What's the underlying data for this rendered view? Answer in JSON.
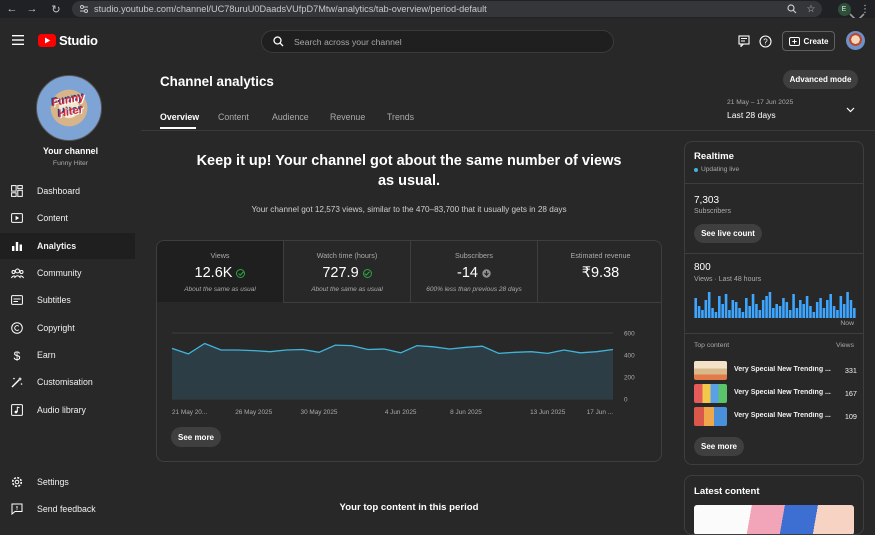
{
  "browser": {
    "url": "studio.youtube.com/channel/UC78uruU0DaadsVUfpD7Mtw/analytics/tab-overview/period-default",
    "profile_initial": "E"
  },
  "topbar": {
    "logo_text": "Studio",
    "search_placeholder": "Search across your channel",
    "create_label": "Create"
  },
  "sidebar": {
    "channel_name": "Your channel",
    "channel_handle": "Funny Hiter",
    "items": [
      {
        "label": "Dashboard",
        "icon": "dashboard-icon"
      },
      {
        "label": "Content",
        "icon": "content-icon"
      },
      {
        "label": "Analytics",
        "icon": "analytics-icon",
        "active": true
      },
      {
        "label": "Community",
        "icon": "community-icon"
      },
      {
        "label": "Subtitles",
        "icon": "subtitles-icon"
      },
      {
        "label": "Copyright",
        "icon": "copyright-icon"
      },
      {
        "label": "Earn",
        "icon": "earn-icon"
      },
      {
        "label": "Customisation",
        "icon": "customisation-icon"
      },
      {
        "label": "Audio library",
        "icon": "audio-library-icon"
      }
    ],
    "bottom": [
      {
        "label": "Settings",
        "icon": "gear-icon"
      },
      {
        "label": "Send feedback",
        "icon": "feedback-icon"
      }
    ]
  },
  "main": {
    "title": "Channel analytics",
    "advanced_mode_label": "Advanced mode",
    "tabs": [
      "Overview",
      "Content",
      "Audience",
      "Revenue",
      "Trends"
    ],
    "active_tab": "Overview",
    "date_range": "21 May – 17 Jun 2025",
    "period_label": "Last 28 days",
    "headline": "Keep it up! Your channel got about the same number of views as usual.",
    "headline_line1": "Keep it up! Your channel got about the same number of views",
    "headline_line2": "as usual.",
    "subline": "Your channel got 12,573 views, similar to the 470–83,700 that it usually gets in 28 days",
    "metrics": [
      {
        "label": "Views",
        "value": "12.6K",
        "sub": "About the same as usual",
        "status": "check"
      },
      {
        "label": "Watch time (hours)",
        "value": "727.9",
        "sub": "About the same as usual",
        "status": "check"
      },
      {
        "label": "Subscribers",
        "value": "-14",
        "sub": "600% less than previous 28 days",
        "status": "down"
      },
      {
        "label": "Estimated revenue",
        "value": "₹9.38",
        "sub": "",
        "status": ""
      }
    ],
    "see_more_label": "See more",
    "top_content_heading": "Your top content in this period"
  },
  "chart_data": {
    "type": "area",
    "series": [
      {
        "values": [
          460,
          410,
          505,
          445,
          445,
          440,
          430,
          445,
          450,
          425,
          490,
          485,
          450,
          455,
          420,
          485,
          475,
          455,
          470,
          480,
          415,
          425,
          430,
          415,
          445,
          420,
          430,
          450
        ]
      }
    ],
    "x_tick_labels": [
      "21 May 20...",
      "26 May 2025",
      "30 May 2025",
      "4 Jun 2025",
      "8 Jun 2025",
      "13 Jun 2025",
      "17 Jun ..."
    ],
    "y_tick_labels": [
      "600",
      "400",
      "200",
      "0"
    ],
    "ylim": [
      0,
      600
    ],
    "grid": true,
    "line_color": "#41b4d9",
    "fill_color": "#2d3d45"
  },
  "realtime": {
    "title": "Realtime",
    "status": "Updating live",
    "subscribers_value": "7,303",
    "subscribers_label": "Subscribers",
    "see_live_label": "See live count",
    "views_value": "800",
    "views_label": "Views · Last 48 hours",
    "now_label": "Now",
    "bars": [
      10,
      6,
      4,
      9,
      13,
      5,
      3,
      11,
      7,
      12,
      4,
      9,
      8,
      5,
      3,
      10,
      6,
      12,
      7,
      4,
      9,
      11,
      13,
      5,
      7,
      6,
      10,
      8,
      4,
      12,
      5,
      9,
      7,
      11,
      6,
      3,
      8,
      10,
      5,
      9,
      12,
      6,
      4,
      11,
      7,
      13,
      9,
      5
    ],
    "bar_color": "#3ea6ff",
    "top_content_label": "Top content",
    "views_col_label": "Views",
    "items": [
      {
        "title": "Very Special New Trending ...",
        "views": "331"
      },
      {
        "title": "Very Special New Trending ...",
        "views": "167"
      },
      {
        "title": "Very Special New Trending ...",
        "views": "109"
      }
    ],
    "see_more_label": "See more"
  },
  "latest": {
    "title": "Latest content"
  }
}
